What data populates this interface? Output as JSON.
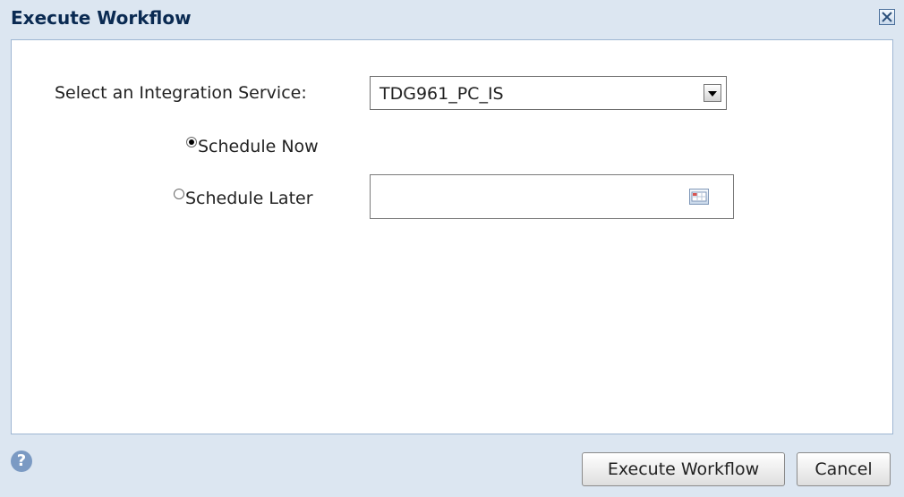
{
  "dialog": {
    "title": "Execute Workflow",
    "colors": {
      "titlebar": "#dce6f1",
      "title_text": "#0a2a52",
      "border": "#9eb6d2"
    }
  },
  "form": {
    "integration_service_label": "Select an Integration Service:",
    "integration_service_value": "TDG961_PC_IS",
    "schedule_now_label": "Schedule Now",
    "schedule_now_selected": true,
    "schedule_later_label": "Schedule Later",
    "schedule_later_selected": false,
    "schedule_later_value": "",
    "calendar_icon": "calendar-icon"
  },
  "footer": {
    "help_icon": "help-icon",
    "help_glyph": "?",
    "execute_label": "Execute Workflow",
    "cancel_label": "Cancel"
  }
}
